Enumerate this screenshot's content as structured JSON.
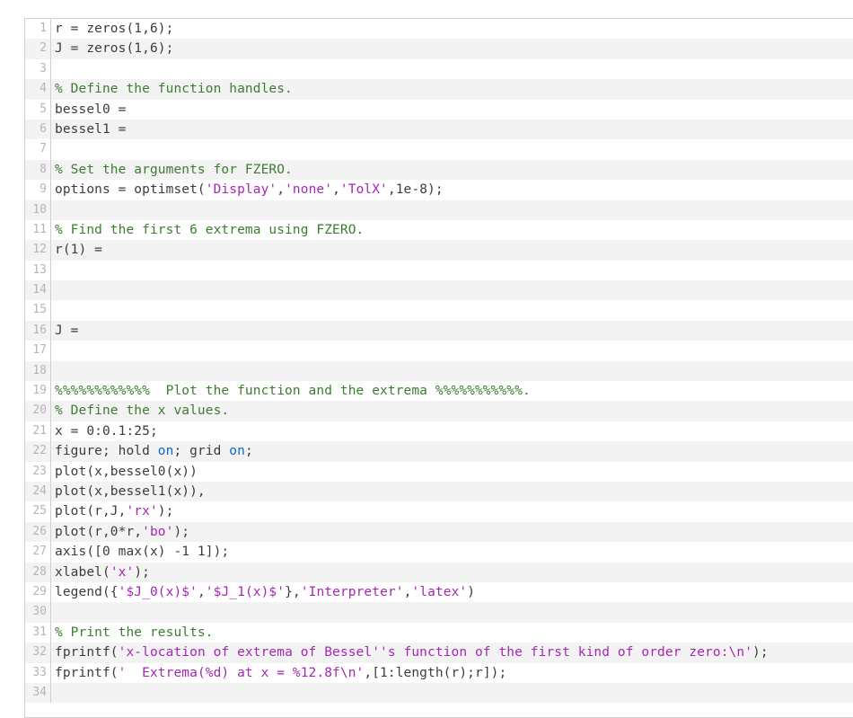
{
  "lines": [
    {
      "stripe": "light",
      "tokens": [
        {
          "t": "normal",
          "s": "r = zeros(1,6);"
        }
      ]
    },
    {
      "stripe": "dark",
      "tokens": [
        {
          "t": "normal",
          "s": "J = zeros(1,6);"
        }
      ]
    },
    {
      "stripe": "light",
      "tokens": []
    },
    {
      "stripe": "dark",
      "tokens": [
        {
          "t": "comment",
          "s": "% Define the function handles."
        }
      ]
    },
    {
      "stripe": "light",
      "tokens": [
        {
          "t": "normal",
          "s": "bessel0 = "
        }
      ]
    },
    {
      "stripe": "dark",
      "tokens": [
        {
          "t": "normal",
          "s": "bessel1 = "
        }
      ]
    },
    {
      "stripe": "light",
      "tokens": []
    },
    {
      "stripe": "dark",
      "tokens": [
        {
          "t": "comment",
          "s": "% Set the arguments for FZERO."
        }
      ]
    },
    {
      "stripe": "light",
      "tokens": [
        {
          "t": "normal",
          "s": "options = optimset("
        },
        {
          "t": "string",
          "s": "'Display'"
        },
        {
          "t": "normal",
          "s": ","
        },
        {
          "t": "string",
          "s": "'none'"
        },
        {
          "t": "normal",
          "s": ","
        },
        {
          "t": "string",
          "s": "'TolX'"
        },
        {
          "t": "normal",
          "s": ",1e-8);"
        }
      ]
    },
    {
      "stripe": "dark",
      "tokens": []
    },
    {
      "stripe": "light",
      "tokens": [
        {
          "t": "comment",
          "s": "% Find the first 6 extrema using FZERO."
        }
      ]
    },
    {
      "stripe": "dark",
      "tokens": [
        {
          "t": "normal",
          "s": "r(1) = "
        }
      ]
    },
    {
      "stripe": "light",
      "tokens": []
    },
    {
      "stripe": "dark",
      "tokens": []
    },
    {
      "stripe": "light",
      "tokens": []
    },
    {
      "stripe": "dark",
      "tokens": [
        {
          "t": "normal",
          "s": "J = "
        }
      ]
    },
    {
      "stripe": "light",
      "tokens": []
    },
    {
      "stripe": "dark",
      "tokens": []
    },
    {
      "stripe": "light",
      "tokens": [
        {
          "t": "comment",
          "s": "%%%%%%%%%%%%  Plot the function and the extrema %%%%%%%%%%%."
        }
      ]
    },
    {
      "stripe": "dark",
      "tokens": [
        {
          "t": "comment",
          "s": "% Define the x values."
        }
      ]
    },
    {
      "stripe": "light",
      "tokens": [
        {
          "t": "normal",
          "s": "x = 0:0.1:25;"
        }
      ]
    },
    {
      "stripe": "dark",
      "tokens": [
        {
          "t": "normal",
          "s": "figure; hold "
        },
        {
          "t": "keyword",
          "s": "on"
        },
        {
          "t": "normal",
          "s": "; grid "
        },
        {
          "t": "keyword",
          "s": "on"
        },
        {
          "t": "normal",
          "s": ";"
        }
      ]
    },
    {
      "stripe": "light",
      "tokens": [
        {
          "t": "normal",
          "s": "plot(x,bessel0(x))"
        }
      ]
    },
    {
      "stripe": "dark",
      "tokens": [
        {
          "t": "normal",
          "s": "plot(x,bessel1(x)),"
        }
      ]
    },
    {
      "stripe": "light",
      "tokens": [
        {
          "t": "normal",
          "s": "plot(r,J,"
        },
        {
          "t": "string",
          "s": "'rx'"
        },
        {
          "t": "normal",
          "s": ");"
        }
      ]
    },
    {
      "stripe": "dark",
      "tokens": [
        {
          "t": "normal",
          "s": "plot(r,0*r,"
        },
        {
          "t": "string",
          "s": "'bo'"
        },
        {
          "t": "normal",
          "s": ");"
        }
      ]
    },
    {
      "stripe": "light",
      "tokens": [
        {
          "t": "normal",
          "s": "axis([0 max(x) -1 1]);"
        }
      ]
    },
    {
      "stripe": "dark",
      "tokens": [
        {
          "t": "normal",
          "s": "xlabel("
        },
        {
          "t": "string",
          "s": "'x'"
        },
        {
          "t": "normal",
          "s": ");"
        }
      ]
    },
    {
      "stripe": "light",
      "tokens": [
        {
          "t": "normal",
          "s": "legend({"
        },
        {
          "t": "string",
          "s": "'$J_0(x)$'"
        },
        {
          "t": "normal",
          "s": ","
        },
        {
          "t": "string",
          "s": "'$J_1(x)$'"
        },
        {
          "t": "normal",
          "s": "},"
        },
        {
          "t": "string",
          "s": "'Interpreter'"
        },
        {
          "t": "normal",
          "s": ","
        },
        {
          "t": "string",
          "s": "'latex'"
        },
        {
          "t": "normal",
          "s": ")"
        }
      ]
    },
    {
      "stripe": "dark",
      "tokens": []
    },
    {
      "stripe": "light",
      "tokens": [
        {
          "t": "comment",
          "s": "% Print the results."
        }
      ]
    },
    {
      "stripe": "dark",
      "tokens": [
        {
          "t": "normal",
          "s": "fprintf("
        },
        {
          "t": "string",
          "s": "'x-location of extrema of Bessel''s function of the first kind of order zero:\\n'"
        },
        {
          "t": "normal",
          "s": ");"
        }
      ]
    },
    {
      "stripe": "light",
      "tokens": [
        {
          "t": "normal",
          "s": "fprintf("
        },
        {
          "t": "string",
          "s": "'  Extrema(%d) at x = %12.8f\\n'"
        },
        {
          "t": "normal",
          "s": ",[1:length(r);r]);"
        }
      ]
    },
    {
      "stripe": "dark",
      "tokens": []
    }
  ]
}
